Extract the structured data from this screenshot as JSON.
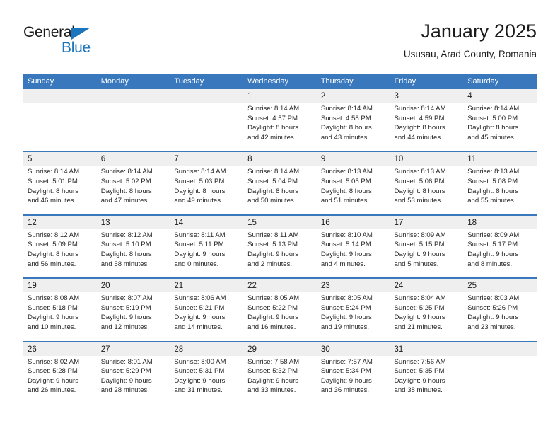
{
  "brand": {
    "name_part1": "General",
    "name_part2": "Blue",
    "accent_color": "#1b75bc"
  },
  "header": {
    "title": "January 2025",
    "location": "Ususau, Arad County, Romania"
  },
  "calendar": {
    "header_bg": "#3a78bd",
    "date_band_bg": "#efefef",
    "weekday_headers": [
      "Sunday",
      "Monday",
      "Tuesday",
      "Wednesday",
      "Thursday",
      "Friday",
      "Saturday"
    ],
    "weeks": [
      [
        {
          "day": "",
          "sunrise": "",
          "sunset": "",
          "daylight_line1": "",
          "daylight_line2": ""
        },
        {
          "day": "",
          "sunrise": "",
          "sunset": "",
          "daylight_line1": "",
          "daylight_line2": ""
        },
        {
          "day": "",
          "sunrise": "",
          "sunset": "",
          "daylight_line1": "",
          "daylight_line2": ""
        },
        {
          "day": "1",
          "sunrise": "Sunrise: 8:14 AM",
          "sunset": "Sunset: 4:57 PM",
          "daylight_line1": "Daylight: 8 hours",
          "daylight_line2": "and 42 minutes."
        },
        {
          "day": "2",
          "sunrise": "Sunrise: 8:14 AM",
          "sunset": "Sunset: 4:58 PM",
          "daylight_line1": "Daylight: 8 hours",
          "daylight_line2": "and 43 minutes."
        },
        {
          "day": "3",
          "sunrise": "Sunrise: 8:14 AM",
          "sunset": "Sunset: 4:59 PM",
          "daylight_line1": "Daylight: 8 hours",
          "daylight_line2": "and 44 minutes."
        },
        {
          "day": "4",
          "sunrise": "Sunrise: 8:14 AM",
          "sunset": "Sunset: 5:00 PM",
          "daylight_line1": "Daylight: 8 hours",
          "daylight_line2": "and 45 minutes."
        }
      ],
      [
        {
          "day": "5",
          "sunrise": "Sunrise: 8:14 AM",
          "sunset": "Sunset: 5:01 PM",
          "daylight_line1": "Daylight: 8 hours",
          "daylight_line2": "and 46 minutes."
        },
        {
          "day": "6",
          "sunrise": "Sunrise: 8:14 AM",
          "sunset": "Sunset: 5:02 PM",
          "daylight_line1": "Daylight: 8 hours",
          "daylight_line2": "and 47 minutes."
        },
        {
          "day": "7",
          "sunrise": "Sunrise: 8:14 AM",
          "sunset": "Sunset: 5:03 PM",
          "daylight_line1": "Daylight: 8 hours",
          "daylight_line2": "and 49 minutes."
        },
        {
          "day": "8",
          "sunrise": "Sunrise: 8:14 AM",
          "sunset": "Sunset: 5:04 PM",
          "daylight_line1": "Daylight: 8 hours",
          "daylight_line2": "and 50 minutes."
        },
        {
          "day": "9",
          "sunrise": "Sunrise: 8:13 AM",
          "sunset": "Sunset: 5:05 PM",
          "daylight_line1": "Daylight: 8 hours",
          "daylight_line2": "and 51 minutes."
        },
        {
          "day": "10",
          "sunrise": "Sunrise: 8:13 AM",
          "sunset": "Sunset: 5:06 PM",
          "daylight_line1": "Daylight: 8 hours",
          "daylight_line2": "and 53 minutes."
        },
        {
          "day": "11",
          "sunrise": "Sunrise: 8:13 AM",
          "sunset": "Sunset: 5:08 PM",
          "daylight_line1": "Daylight: 8 hours",
          "daylight_line2": "and 55 minutes."
        }
      ],
      [
        {
          "day": "12",
          "sunrise": "Sunrise: 8:12 AM",
          "sunset": "Sunset: 5:09 PM",
          "daylight_line1": "Daylight: 8 hours",
          "daylight_line2": "and 56 minutes."
        },
        {
          "day": "13",
          "sunrise": "Sunrise: 8:12 AM",
          "sunset": "Sunset: 5:10 PM",
          "daylight_line1": "Daylight: 8 hours",
          "daylight_line2": "and 58 minutes."
        },
        {
          "day": "14",
          "sunrise": "Sunrise: 8:11 AM",
          "sunset": "Sunset: 5:11 PM",
          "daylight_line1": "Daylight: 9 hours",
          "daylight_line2": "and 0 minutes."
        },
        {
          "day": "15",
          "sunrise": "Sunrise: 8:11 AM",
          "sunset": "Sunset: 5:13 PM",
          "daylight_line1": "Daylight: 9 hours",
          "daylight_line2": "and 2 minutes."
        },
        {
          "day": "16",
          "sunrise": "Sunrise: 8:10 AM",
          "sunset": "Sunset: 5:14 PM",
          "daylight_line1": "Daylight: 9 hours",
          "daylight_line2": "and 4 minutes."
        },
        {
          "day": "17",
          "sunrise": "Sunrise: 8:09 AM",
          "sunset": "Sunset: 5:15 PM",
          "daylight_line1": "Daylight: 9 hours",
          "daylight_line2": "and 5 minutes."
        },
        {
          "day": "18",
          "sunrise": "Sunrise: 8:09 AM",
          "sunset": "Sunset: 5:17 PM",
          "daylight_line1": "Daylight: 9 hours",
          "daylight_line2": "and 8 minutes."
        }
      ],
      [
        {
          "day": "19",
          "sunrise": "Sunrise: 8:08 AM",
          "sunset": "Sunset: 5:18 PM",
          "daylight_line1": "Daylight: 9 hours",
          "daylight_line2": "and 10 minutes."
        },
        {
          "day": "20",
          "sunrise": "Sunrise: 8:07 AM",
          "sunset": "Sunset: 5:19 PM",
          "daylight_line1": "Daylight: 9 hours",
          "daylight_line2": "and 12 minutes."
        },
        {
          "day": "21",
          "sunrise": "Sunrise: 8:06 AM",
          "sunset": "Sunset: 5:21 PM",
          "daylight_line1": "Daylight: 9 hours",
          "daylight_line2": "and 14 minutes."
        },
        {
          "day": "22",
          "sunrise": "Sunrise: 8:05 AM",
          "sunset": "Sunset: 5:22 PM",
          "daylight_line1": "Daylight: 9 hours",
          "daylight_line2": "and 16 minutes."
        },
        {
          "day": "23",
          "sunrise": "Sunrise: 8:05 AM",
          "sunset": "Sunset: 5:24 PM",
          "daylight_line1": "Daylight: 9 hours",
          "daylight_line2": "and 19 minutes."
        },
        {
          "day": "24",
          "sunrise": "Sunrise: 8:04 AM",
          "sunset": "Sunset: 5:25 PM",
          "daylight_line1": "Daylight: 9 hours",
          "daylight_line2": "and 21 minutes."
        },
        {
          "day": "25",
          "sunrise": "Sunrise: 8:03 AM",
          "sunset": "Sunset: 5:26 PM",
          "daylight_line1": "Daylight: 9 hours",
          "daylight_line2": "and 23 minutes."
        }
      ],
      [
        {
          "day": "26",
          "sunrise": "Sunrise: 8:02 AM",
          "sunset": "Sunset: 5:28 PM",
          "daylight_line1": "Daylight: 9 hours",
          "daylight_line2": "and 26 minutes."
        },
        {
          "day": "27",
          "sunrise": "Sunrise: 8:01 AM",
          "sunset": "Sunset: 5:29 PM",
          "daylight_line1": "Daylight: 9 hours",
          "daylight_line2": "and 28 minutes."
        },
        {
          "day": "28",
          "sunrise": "Sunrise: 8:00 AM",
          "sunset": "Sunset: 5:31 PM",
          "daylight_line1": "Daylight: 9 hours",
          "daylight_line2": "and 31 minutes."
        },
        {
          "day": "29",
          "sunrise": "Sunrise: 7:58 AM",
          "sunset": "Sunset: 5:32 PM",
          "daylight_line1": "Daylight: 9 hours",
          "daylight_line2": "and 33 minutes."
        },
        {
          "day": "30",
          "sunrise": "Sunrise: 7:57 AM",
          "sunset": "Sunset: 5:34 PM",
          "daylight_line1": "Daylight: 9 hours",
          "daylight_line2": "and 36 minutes."
        },
        {
          "day": "31",
          "sunrise": "Sunrise: 7:56 AM",
          "sunset": "Sunset: 5:35 PM",
          "daylight_line1": "Daylight: 9 hours",
          "daylight_line2": "and 38 minutes."
        },
        {
          "day": "",
          "sunrise": "",
          "sunset": "",
          "daylight_line1": "",
          "daylight_line2": ""
        }
      ]
    ]
  }
}
